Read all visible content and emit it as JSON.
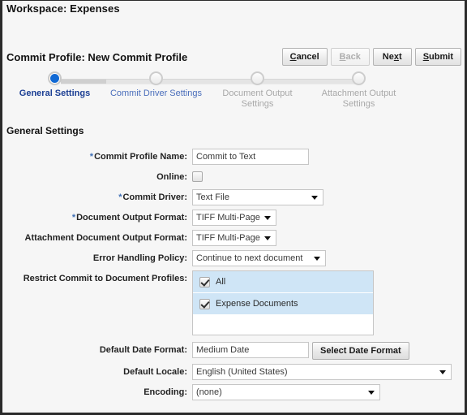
{
  "workspace": {
    "title": "Workspace: Expenses"
  },
  "header": {
    "profile_title": "Commit Profile: New Commit Profile",
    "buttons": [
      {
        "label": "Cancel",
        "mnemonic_index": 0,
        "disabled": false
      },
      {
        "label": "Back",
        "mnemonic_index": 0,
        "disabled": true
      },
      {
        "label": "Next",
        "mnemonic_index": 2,
        "disabled": false
      },
      {
        "label": "Submit",
        "mnemonic_index": 0,
        "disabled": false
      }
    ]
  },
  "stepper": {
    "steps": [
      {
        "label": "General Settings",
        "state": "current"
      },
      {
        "label": "Commit Driver Settings",
        "state": "next"
      },
      {
        "label": "Document Output Settings",
        "state": "pending"
      },
      {
        "label": "Attachment Output Settings",
        "state": "pending"
      }
    ],
    "active_color": "#1169d4"
  },
  "section": {
    "title": "General Settings"
  },
  "fields": {
    "commit_profile_name": {
      "label": "Commit Profile Name:",
      "required": true,
      "value": "Commit to Text"
    },
    "online": {
      "label": "Online:",
      "required": false,
      "checked": false
    },
    "commit_driver": {
      "label": "Commit Driver:",
      "required": true,
      "value": "Text File"
    },
    "document_output_format": {
      "label": "Document Output Format:",
      "required": true,
      "value": "TIFF Multi-Page"
    },
    "attachment_document_output_format": {
      "label": "Attachment Document Output Format:",
      "required": false,
      "value": "TIFF Multi-Page"
    },
    "error_handling_policy": {
      "label": "Error Handling Policy:",
      "required": false,
      "value": "Continue to next document"
    },
    "restrict_commit": {
      "label": "Restrict Commit to Document Profiles:",
      "required": false,
      "options": [
        {
          "label": "All",
          "checked": true,
          "selected": true
        },
        {
          "label": "Expense Documents",
          "checked": true,
          "selected": true
        }
      ]
    },
    "default_date_format": {
      "label": "Default Date Format:",
      "required": false,
      "value": "Medium Date",
      "button_label": "Select Date Format"
    },
    "default_locale": {
      "label": "Default Locale:",
      "required": false,
      "value": "English (United States)"
    },
    "encoding": {
      "label": "Encoding:",
      "required": false,
      "value": "(none)"
    }
  },
  "icons": {
    "required_marker": "*",
    "dropdown_arrow": "chevron-down-icon",
    "checkbox_check": "check-icon"
  }
}
